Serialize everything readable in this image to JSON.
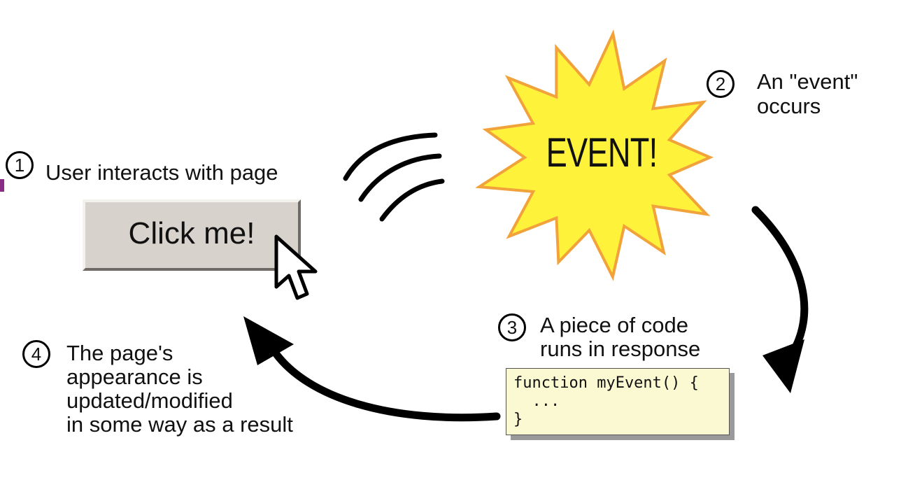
{
  "steps": {
    "step1": {
      "number": "1",
      "text": "User interacts with page"
    },
    "step2": {
      "number": "2",
      "line1": "An \"event\"",
      "line2": "occurs"
    },
    "step3": {
      "number": "3",
      "line1": "A piece of code",
      "line2": "runs in response"
    },
    "step4": {
      "number": "4",
      "line1": "The page's",
      "line2": "appearance is",
      "line3": "updated/modified",
      "line4": "in some way as a result"
    }
  },
  "button": {
    "label": "Click me!"
  },
  "burst": {
    "label": "EVENT!"
  },
  "code": {
    "line1": "function myEvent() {",
    "line2": "  ...",
    "line3": "}"
  },
  "colors": {
    "burst_fill": "#fff23a",
    "burst_stroke": "#f2a23a",
    "code_bg": "#fbf9d2",
    "button_bg": "#d8d2cc"
  },
  "icons": [
    "mouse-cursor-icon",
    "signal-waves-icon",
    "curved-arrow-icon"
  ]
}
